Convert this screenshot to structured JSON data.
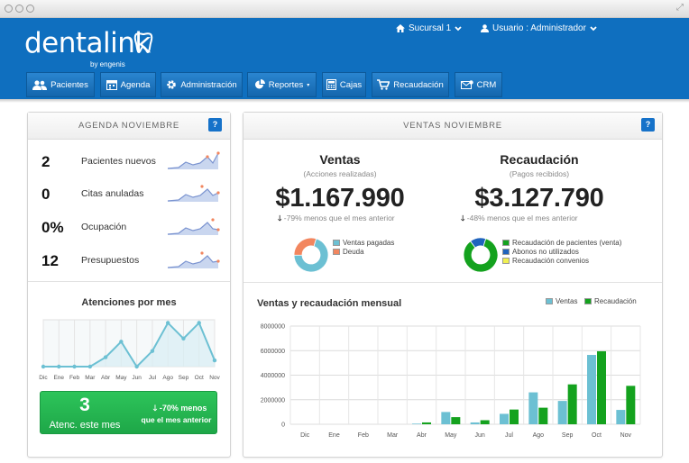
{
  "app": {
    "brand": "dentalink",
    "brand_sub": "by engenis",
    "branch": "Sucursal 1",
    "user": "Usuario : Administrador"
  },
  "nav": [
    {
      "label": "Pacientes",
      "icon": "users-icon"
    },
    {
      "label": "Agenda",
      "icon": "calendar-icon"
    },
    {
      "label": "Administración",
      "icon": "gear-icon"
    },
    {
      "label": "Reportes",
      "icon": "pie-chart-icon"
    },
    {
      "label": "Cajas",
      "icon": "calculator-icon"
    },
    {
      "label": "Recaudación",
      "icon": "cart-icon"
    },
    {
      "label": "CRM",
      "icon": "mail-icon"
    }
  ],
  "agenda": {
    "title": "AGENDA NOVIEMBRE",
    "help": "?",
    "stats": [
      {
        "value": "2",
        "label": "Pacientes nuevos"
      },
      {
        "value": "0",
        "label": "Citas anuladas"
      },
      {
        "value": "0%",
        "label": "Ocupación"
      },
      {
        "value": "12",
        "label": "Presupuestos"
      }
    ],
    "atenciones_title": "Atenciones por mes",
    "summary": {
      "value": "3",
      "label": "Atenc. este mes",
      "delta": "-70% menos",
      "delta_note": "que el mes anterior"
    }
  },
  "ventas": {
    "title": "VENTAS NOVIEMBRE",
    "help": "?",
    "ventas": {
      "heading": "Ventas",
      "sub": "(Acciones realizadas)",
      "amount": "$1.167.990",
      "delta": "-79% menos que el mes anterior",
      "legend": [
        "Ventas pagadas",
        "Deuda"
      ]
    },
    "recaudacion": {
      "heading": "Recaudación",
      "sub": "(Pagos recibidos)",
      "amount": "$3.127.790",
      "delta": "-48% menos que el mes anterior",
      "legend": [
        "Recaudación de pacientes (venta)",
        "Abonos no utilizados",
        "Recaudación convenios"
      ]
    },
    "monthly_title": "Ventas y recaudación mensual"
  },
  "colors": {
    "blue": "#0f6fbf",
    "teal": "#6cc0d3",
    "green": "#14a21e",
    "orange": "#f2865f",
    "yellow": "#f0f050",
    "navy": "#1f63bd"
  },
  "chart_data": [
    {
      "type": "line",
      "title": "Atenciones por mes",
      "categories": [
        "Dic",
        "Ene",
        "Feb",
        "Mar",
        "Abr",
        "May",
        "Jun",
        "Jul",
        "Ago",
        "Sep",
        "Oct",
        "Nov"
      ],
      "values": [
        0,
        0,
        0,
        0,
        3,
        8,
        0,
        5,
        14,
        9,
        14,
        2
      ]
    },
    {
      "type": "pie",
      "title": "Ventas",
      "labels": [
        "Ventas pagadas",
        "Deuda"
      ],
      "values": [
        70,
        30
      ]
    },
    {
      "type": "pie",
      "title": "Recaudación",
      "labels": [
        "Recaudación de pacientes (venta)",
        "Abonos no utilizados",
        "Recaudación convenios"
      ],
      "values": [
        85,
        15,
        0
      ]
    },
    {
      "type": "bar",
      "title": "Ventas y recaudación mensual",
      "categories": [
        "Dic",
        "Ene",
        "Feb",
        "Mar",
        "Abr",
        "May",
        "Jun",
        "Jul",
        "Ago",
        "Sep",
        "Oct",
        "Nov"
      ],
      "series": [
        {
          "name": "Ventas",
          "values": [
            0,
            0,
            0,
            0,
            50000,
            1000000,
            150000,
            850000,
            2600000,
            1900000,
            5650000,
            1170000
          ]
        },
        {
          "name": "Recaudación",
          "values": [
            0,
            0,
            0,
            0,
            150000,
            580000,
            330000,
            1200000,
            1350000,
            3250000,
            5950000,
            3130000
          ]
        }
      ],
      "yticks": [
        "0",
        "2000000",
        "4000000",
        "6000000",
        "8000000"
      ],
      "ylim": [
        0,
        8000000
      ]
    }
  ]
}
